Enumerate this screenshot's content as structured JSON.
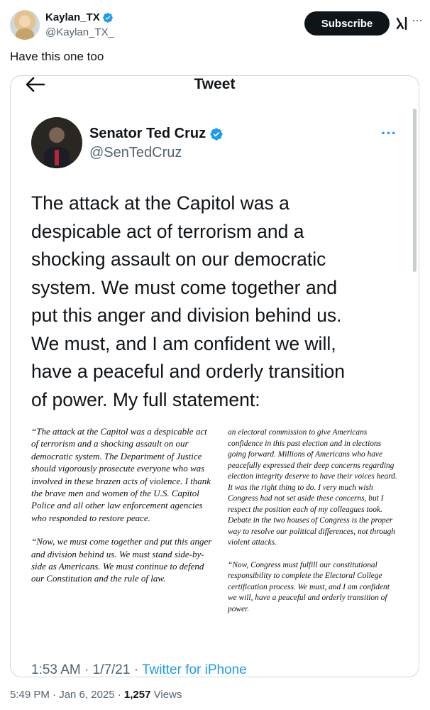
{
  "post": {
    "author_name": "Kaylan_TX",
    "author_handle": "@Kaylan_TX_",
    "subscribe_label": "Subscribe",
    "more_glyph": "···",
    "text": "Have this one too",
    "timestamp": "5:49 PM · Jan 6, 2025 · ",
    "views_count": "1,257",
    "views_label": " Views"
  },
  "embedded": {
    "header_title": "Tweet",
    "author_name": "Senator Ted Cruz",
    "author_handle": "@SenTedCruz",
    "more_glyph": "···",
    "body_lines": [
      "The attack at the Capitol was a",
      "despicable act of terrorism and a",
      "shocking assault on our democratic",
      "system. We must come together and",
      "put this anger and division behind us.",
      "We must, and I am confident we will,",
      "have a peaceful and orderly transition",
      "of power. My full statement:"
    ],
    "statement_left": [
      "“The attack at the Capitol was a despicable act of terrorism and a shocking assault on our democratic system. The Department of Justice should vigorously prosecute everyone who was involved in these brazen acts of violence. I thank the brave men and women of the U.S. Capitol Police and all other law enforcement agencies who responded to restore peace.",
      "“Now, we must come together and put this anger and division behind us. We must stand side-by-side as Americans. We must continue to defend our Constitution and the rule of law."
    ],
    "statement_right": [
      "an electoral commission to give Americans confidence in this past election and in elections going forward. Millions of Americans who have peacefully expressed their deep concerns regarding election integrity deserve to have their voices heard. It was the right thing to do. I very much wish Congress had not set aside these concerns, but I respect the position each of my colleagues took. Debate in the two houses of Congress is the proper way to resolve our political differences, not through violent attacks.",
      "“Now, Congress must fulfill our constitutional responsibility to complete the Electoral College certification process. We must, and I am confident we will, have a peaceful and orderly transition of power."
    ],
    "timestamp": "1:53 AM · 1/7/21 · ",
    "source": "Twitter for iPhone"
  },
  "colors": {
    "verified_blue": "#1d9bf0",
    "text_primary": "#0f1419",
    "text_secondary": "#536471"
  }
}
